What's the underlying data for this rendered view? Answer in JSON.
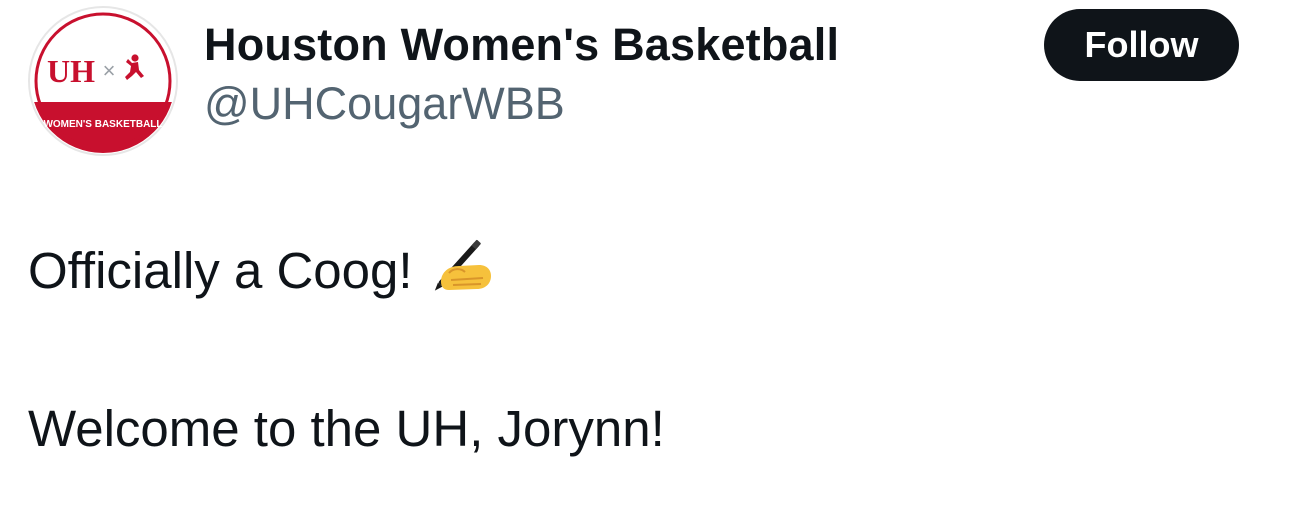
{
  "account": {
    "display_name": "Houston Women's Basketball",
    "handle": "@UHCougarWBB",
    "avatar": {
      "logo_text": "UH",
      "separator": "×",
      "banner_text": "WOMEN'S BASKETBALL"
    }
  },
  "actions": {
    "follow_label": "Follow"
  },
  "tweet": {
    "line1": "Officially a Coog!",
    "line1_emoji": "writing-hand-icon",
    "line2": "Welcome to the UH, Jorynn!"
  },
  "colors": {
    "text": "#0f1419",
    "secondary_text": "#536471",
    "button_bg": "#0f1419",
    "brand_red": "#c8102e"
  }
}
